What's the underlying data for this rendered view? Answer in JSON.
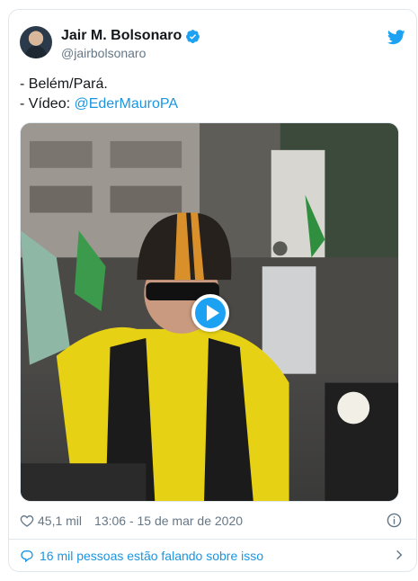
{
  "author": {
    "display_name": "Jair M. Bolsonaro",
    "handle": "@jairbolsonaro",
    "verified": true
  },
  "tweet": {
    "line1": "- Belém/Pará.",
    "line2_prefix": "- Vídeo: ",
    "line2_link": "@EderMauroPA"
  },
  "media": {
    "type": "video",
    "play_icon": "play-icon"
  },
  "meta": {
    "likes": "45,1 mil",
    "timestamp": "13:06 - 15 de mar de 2020"
  },
  "footer": {
    "conversation": "16 mil pessoas estão falando sobre isso"
  },
  "colors": {
    "accent": "#1da1f2",
    "link": "#1b95e0",
    "secondary_text": "#657786",
    "border": "#e1e8ed"
  },
  "icons": {
    "verified": "verified-badge-icon",
    "brand": "twitter-bird-icon",
    "like": "heart-icon",
    "info": "info-icon",
    "reply": "speech-bubble-icon",
    "chevron": "chevron-right-icon"
  }
}
